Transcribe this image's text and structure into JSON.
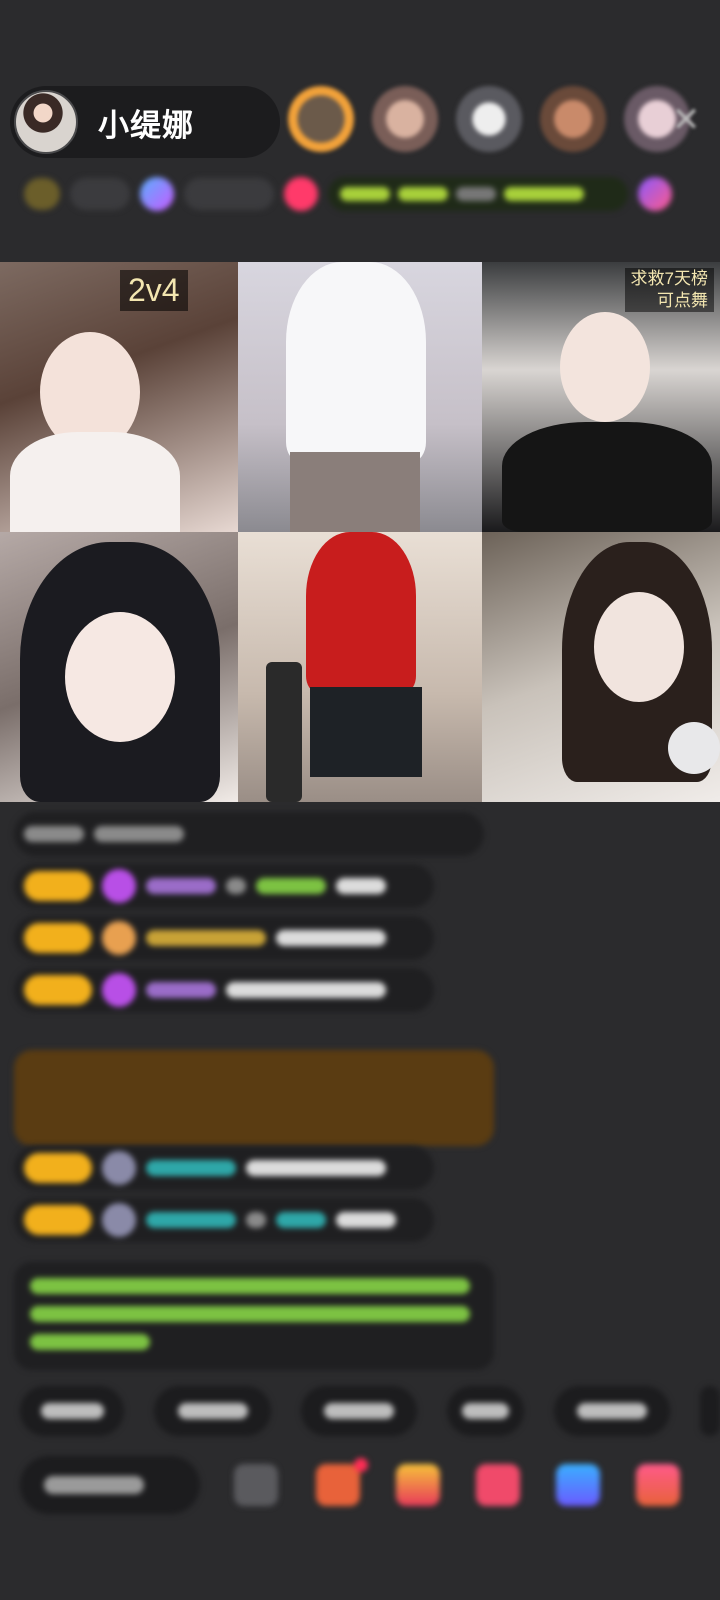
{
  "header": {
    "host_name": "小缇娜",
    "viewer_avatars": [
      "viewer-avatar-1",
      "viewer-avatar-2",
      "viewer-avatar-3",
      "viewer-avatar-4",
      "viewer-avatar-5"
    ],
    "close_icon": "close-icon"
  },
  "grid": {
    "pk_score": "2v4",
    "rank_line1": "求救7天榜",
    "rank_line2": "可点舞"
  },
  "colors": {
    "background": "#2b2b2d",
    "pill": "#1c1c1e",
    "level_badge": "#f2b01c",
    "gift_banner": "#5a3c12",
    "system_text": "#7cc242"
  },
  "icons": [
    "emoji-icon",
    "gift-box-icon",
    "red-envelope-icon",
    "live-pk-icon",
    "game-icon",
    "fan-club-icon"
  ]
}
